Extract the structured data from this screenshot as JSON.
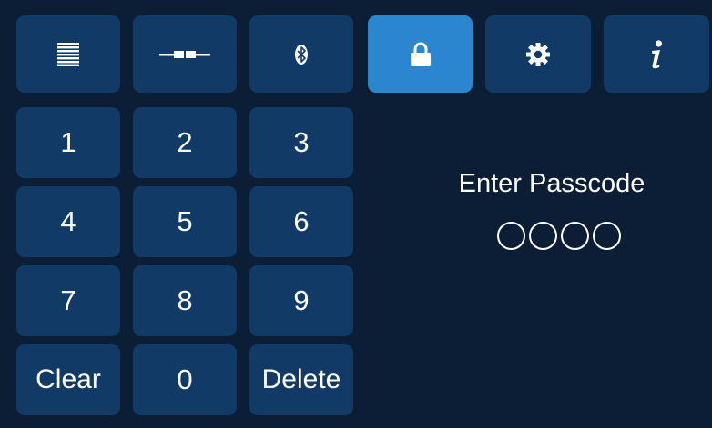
{
  "tabs": [
    {
      "id": "list",
      "icon": "list-icon",
      "active": false
    },
    {
      "id": "connection",
      "icon": "connector-icon",
      "active": false
    },
    {
      "id": "bluetooth",
      "icon": "bluetooth-icon",
      "active": false
    },
    {
      "id": "lock",
      "icon": "lock-icon",
      "active": true
    },
    {
      "id": "settings",
      "icon": "gear-icon",
      "active": false
    },
    {
      "id": "info",
      "icon": "info-icon",
      "active": false
    }
  ],
  "keypad": {
    "keys": [
      "1",
      "2",
      "3",
      "4",
      "5",
      "6",
      "7",
      "8",
      "9",
      "Clear",
      "0",
      "Delete"
    ]
  },
  "passcode": {
    "prompt": "Enter Passcode",
    "digits_entered": 0,
    "digits_total": 4
  },
  "colors": {
    "background": "#0b1e36",
    "button": "#113a66",
    "active_button": "#2b86cf",
    "text": "#ffffff"
  }
}
